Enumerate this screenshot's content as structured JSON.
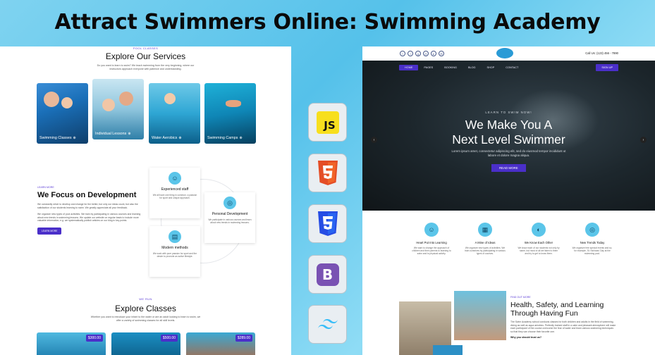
{
  "headline": "Attract Swimmers Online: Swimming Academy",
  "left_page": {
    "services": {
      "eyebrow": "POOL CLASSES",
      "title": "Explore Our Services",
      "desc": "Do you want to learn to swim? We teach swimming from the very beginning, where our instructors approach everyone with patience and understanding.",
      "cards": [
        {
          "label": "Swimming Classes"
        },
        {
          "label": "Individual Lessons"
        },
        {
          "label": "Water Aerobics"
        },
        {
          "label": "Swimming Camps"
        }
      ]
    },
    "focus": {
      "eyebrow": "LEARN MORE",
      "title": "We Focus on Development",
      "p1": "We constantly strive to develop and change for the better, but only our ideas count, but also the satisfaction of our students learning to swim. We greatly appreciate all your feedback.",
      "p2": "We organize new types of pool activities. We train by participating in various courses and learning about new trends in swimming lessons. We update our website on regular basis to include more valuable information, e.g. we systematically publish articles on our blog in key points.",
      "button": "LEARN MORE"
    },
    "features": [
      {
        "title": "Experienced staff",
        "desc": "We all have one thing in common: a passion for sport and unique approach."
      },
      {
        "title": "Personal Development",
        "desc": "We participate in various courses and learn about new trends in swimming lessons."
      },
      {
        "title": "Modern methods",
        "desc": "We work with pure passion for sport and the desire to promote an active lifestyle."
      }
    ],
    "classes": {
      "eyebrow": "WE RUN",
      "title": "Explore Classes",
      "desc": "Whether you want to introduce your infant to the water or are an adult looking to learn to swim, we offer a variety of swimming classes for all skill levels.",
      "prices": [
        "$300.00",
        "$500.00",
        "$289.00"
      ]
    }
  },
  "tech_icons": [
    {
      "name": "JS",
      "bg": "#f7df1e",
      "fg": "#111111"
    },
    {
      "name": "HTML5",
      "bg": "#e44d26",
      "fg": "#ffffff"
    },
    {
      "name": "CSS3",
      "bg": "#264de4",
      "fg": "#ffffff"
    },
    {
      "name": "B",
      "bg": "#7952b3",
      "fg": "#ffffff"
    },
    {
      "name": "Tailwind",
      "bg": "#ffffff",
      "fg": "#38bdf8"
    }
  ],
  "right_page": {
    "call_us": "Call Us: (123) 456 - 7890",
    "nav": [
      "HOME",
      "PAGES",
      "BOOKING",
      "BLOG",
      "SHOP",
      "CONTACT"
    ],
    "signup": "SIGN UP",
    "hero": {
      "eyebrow": "LEARN TO SWIM NOW!",
      "title_line1": "We Make You A",
      "title_line2": "Next Level Swimmer",
      "sub": "Lorem ipsum amet, consectetur adipiscing elit, sed do eiusmod tempor incididunt ut labore et dolore magna aliqua.",
      "button": "READ MORE"
    },
    "features": [
      {
        "title": "Heart Put Into Learning",
        "desc": "We want to change the approach of children and their parents to learning to swim and to physical activity."
      },
      {
        "title": "A Mine of Ideas",
        "desc": "We organize new types of activities. We train ourselves by participating in various types of courses."
      },
      {
        "title": "We Know Each Other",
        "desc": "We know each of our students not only by name, but most of all we listen to them and try to get to know them."
      },
      {
        "title": "New Trends Today",
        "desc": "We organize free special events and so, for example, St. Nicholas' Day at the swimming pool."
      }
    ],
    "lower": {
      "eyebrow": "FIND OUT MORE",
      "title": "Health, Safety, and Learning Through Having Fun",
      "desc": "The Swim Academy school conducts classes for both children and adults in the field of swimming, diving as well as aqua aerobics. Perfectly trained staff in a calm and pleasant atmosphere will make each participant of the course overcome the fear of water and learn various swimming techniques so that they can choose their favorite one.",
      "question": "Why you should trust us?"
    }
  }
}
